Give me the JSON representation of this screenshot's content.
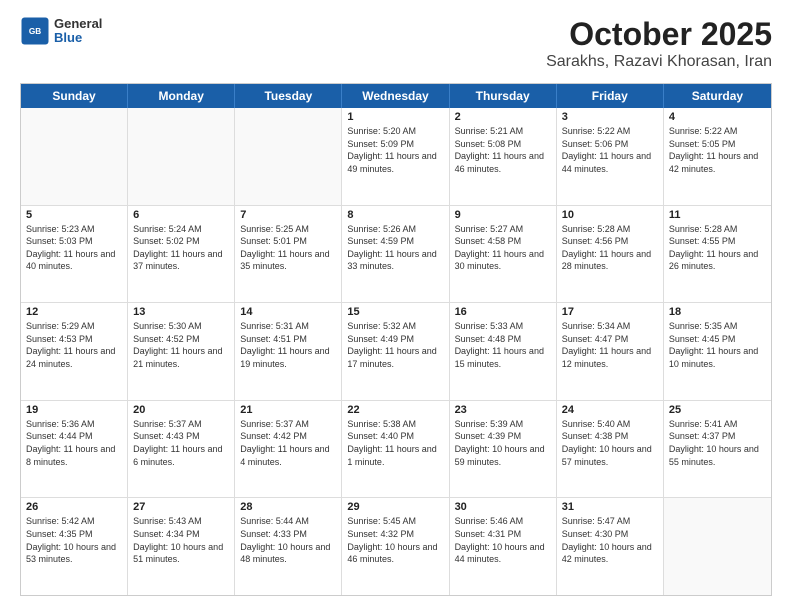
{
  "logo": {
    "general": "General",
    "blue": "Blue"
  },
  "title": "October 2025",
  "subtitle": "Sarakhs, Razavi Khorasan, Iran",
  "weekdays": [
    "Sunday",
    "Monday",
    "Tuesday",
    "Wednesday",
    "Thursday",
    "Friday",
    "Saturday"
  ],
  "rows": [
    [
      {
        "day": "",
        "text": "",
        "empty": true
      },
      {
        "day": "",
        "text": "",
        "empty": true
      },
      {
        "day": "",
        "text": "",
        "empty": true
      },
      {
        "day": "1",
        "text": "Sunrise: 5:20 AM\nSunset: 5:09 PM\nDaylight: 11 hours and 49 minutes.",
        "empty": false
      },
      {
        "day": "2",
        "text": "Sunrise: 5:21 AM\nSunset: 5:08 PM\nDaylight: 11 hours and 46 minutes.",
        "empty": false
      },
      {
        "day": "3",
        "text": "Sunrise: 5:22 AM\nSunset: 5:06 PM\nDaylight: 11 hours and 44 minutes.",
        "empty": false
      },
      {
        "day": "4",
        "text": "Sunrise: 5:22 AM\nSunset: 5:05 PM\nDaylight: 11 hours and 42 minutes.",
        "empty": false
      }
    ],
    [
      {
        "day": "5",
        "text": "Sunrise: 5:23 AM\nSunset: 5:03 PM\nDaylight: 11 hours and 40 minutes.",
        "empty": false
      },
      {
        "day": "6",
        "text": "Sunrise: 5:24 AM\nSunset: 5:02 PM\nDaylight: 11 hours and 37 minutes.",
        "empty": false
      },
      {
        "day": "7",
        "text": "Sunrise: 5:25 AM\nSunset: 5:01 PM\nDaylight: 11 hours and 35 minutes.",
        "empty": false
      },
      {
        "day": "8",
        "text": "Sunrise: 5:26 AM\nSunset: 4:59 PM\nDaylight: 11 hours and 33 minutes.",
        "empty": false
      },
      {
        "day": "9",
        "text": "Sunrise: 5:27 AM\nSunset: 4:58 PM\nDaylight: 11 hours and 30 minutes.",
        "empty": false
      },
      {
        "day": "10",
        "text": "Sunrise: 5:28 AM\nSunset: 4:56 PM\nDaylight: 11 hours and 28 minutes.",
        "empty": false
      },
      {
        "day": "11",
        "text": "Sunrise: 5:28 AM\nSunset: 4:55 PM\nDaylight: 11 hours and 26 minutes.",
        "empty": false
      }
    ],
    [
      {
        "day": "12",
        "text": "Sunrise: 5:29 AM\nSunset: 4:53 PM\nDaylight: 11 hours and 24 minutes.",
        "empty": false
      },
      {
        "day": "13",
        "text": "Sunrise: 5:30 AM\nSunset: 4:52 PM\nDaylight: 11 hours and 21 minutes.",
        "empty": false
      },
      {
        "day": "14",
        "text": "Sunrise: 5:31 AM\nSunset: 4:51 PM\nDaylight: 11 hours and 19 minutes.",
        "empty": false
      },
      {
        "day": "15",
        "text": "Sunrise: 5:32 AM\nSunset: 4:49 PM\nDaylight: 11 hours and 17 minutes.",
        "empty": false
      },
      {
        "day": "16",
        "text": "Sunrise: 5:33 AM\nSunset: 4:48 PM\nDaylight: 11 hours and 15 minutes.",
        "empty": false
      },
      {
        "day": "17",
        "text": "Sunrise: 5:34 AM\nSunset: 4:47 PM\nDaylight: 11 hours and 12 minutes.",
        "empty": false
      },
      {
        "day": "18",
        "text": "Sunrise: 5:35 AM\nSunset: 4:45 PM\nDaylight: 11 hours and 10 minutes.",
        "empty": false
      }
    ],
    [
      {
        "day": "19",
        "text": "Sunrise: 5:36 AM\nSunset: 4:44 PM\nDaylight: 11 hours and 8 minutes.",
        "empty": false
      },
      {
        "day": "20",
        "text": "Sunrise: 5:37 AM\nSunset: 4:43 PM\nDaylight: 11 hours and 6 minutes.",
        "empty": false
      },
      {
        "day": "21",
        "text": "Sunrise: 5:37 AM\nSunset: 4:42 PM\nDaylight: 11 hours and 4 minutes.",
        "empty": false
      },
      {
        "day": "22",
        "text": "Sunrise: 5:38 AM\nSunset: 4:40 PM\nDaylight: 11 hours and 1 minute.",
        "empty": false
      },
      {
        "day": "23",
        "text": "Sunrise: 5:39 AM\nSunset: 4:39 PM\nDaylight: 10 hours and 59 minutes.",
        "empty": false
      },
      {
        "day": "24",
        "text": "Sunrise: 5:40 AM\nSunset: 4:38 PM\nDaylight: 10 hours and 57 minutes.",
        "empty": false
      },
      {
        "day": "25",
        "text": "Sunrise: 5:41 AM\nSunset: 4:37 PM\nDaylight: 10 hours and 55 minutes.",
        "empty": false
      }
    ],
    [
      {
        "day": "26",
        "text": "Sunrise: 5:42 AM\nSunset: 4:35 PM\nDaylight: 10 hours and 53 minutes.",
        "empty": false
      },
      {
        "day": "27",
        "text": "Sunrise: 5:43 AM\nSunset: 4:34 PM\nDaylight: 10 hours and 51 minutes.",
        "empty": false
      },
      {
        "day": "28",
        "text": "Sunrise: 5:44 AM\nSunset: 4:33 PM\nDaylight: 10 hours and 48 minutes.",
        "empty": false
      },
      {
        "day": "29",
        "text": "Sunrise: 5:45 AM\nSunset: 4:32 PM\nDaylight: 10 hours and 46 minutes.",
        "empty": false
      },
      {
        "day": "30",
        "text": "Sunrise: 5:46 AM\nSunset: 4:31 PM\nDaylight: 10 hours and 44 minutes.",
        "empty": false
      },
      {
        "day": "31",
        "text": "Sunrise: 5:47 AM\nSunset: 4:30 PM\nDaylight: 10 hours and 42 minutes.",
        "empty": false
      },
      {
        "day": "",
        "text": "",
        "empty": true
      }
    ]
  ]
}
